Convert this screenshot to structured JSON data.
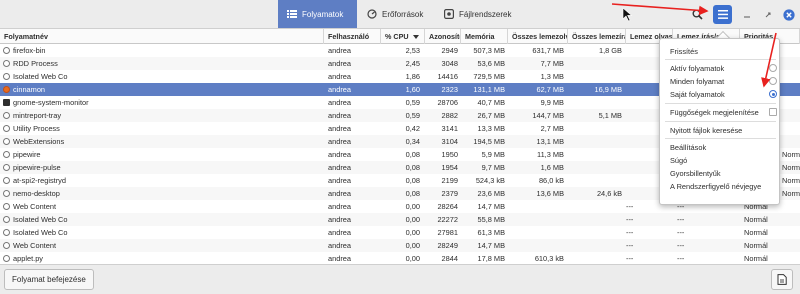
{
  "tabs": [
    {
      "label": "Folyamatok",
      "icon": "list-icon",
      "active": true
    },
    {
      "label": "Erőforrások",
      "icon": "gauge-icon",
      "active": false
    },
    {
      "label": "Fájlrendszerek",
      "icon": "disk-icon",
      "active": false
    }
  ],
  "columns": [
    "Folyamatnév",
    "Felhasználó",
    "% CPU",
    "Azonosító",
    "Memória",
    "Összes lemezolvasás",
    "Összes lemezírás",
    "Lemez olvasás/s",
    "Lemez írás/s",
    "Prioritás"
  ],
  "rows": [
    {
      "name": "firefox-bin",
      "user": "andrea",
      "cpu": "2,53",
      "pid": "2949",
      "mem": "507,3 MB",
      "read": "631,7 MB",
      "write": "1,8 GB",
      "rps": "",
      "wps": "",
      "prio": ""
    },
    {
      "name": "RDD Process",
      "user": "andrea",
      "cpu": "2,45",
      "pid": "3048",
      "mem": "53,6 MB",
      "read": "7,7 MB",
      "write": "",
      "rps": "",
      "wps": "",
      "prio": ""
    },
    {
      "name": "Isolated Web Co",
      "user": "andrea",
      "cpu": "1,86",
      "pid": "14416",
      "mem": "729,5 MB",
      "read": "1,3 MB",
      "write": "",
      "rps": "",
      "wps": "",
      "prio": ""
    },
    {
      "name": "cinnamon",
      "user": "andrea",
      "cpu": "1,60",
      "pid": "2323",
      "mem": "131,1 MB",
      "read": "62,7 MB",
      "write": "16,9 MB",
      "rps": "",
      "wps": "",
      "prio": ""
    },
    {
      "name": "gnome-system-monitor",
      "user": "andrea",
      "cpu": "0,59",
      "pid": "28706",
      "mem": "40,7 MB",
      "read": "9,9 MB",
      "write": "",
      "rps": "",
      "wps": "",
      "prio": ""
    },
    {
      "name": "mintreport-tray",
      "user": "andrea",
      "cpu": "0,59",
      "pid": "2882",
      "mem": "26,7 MB",
      "read": "144,7 MB",
      "write": "5,1 MB",
      "rps": "",
      "wps": "",
      "prio": ""
    },
    {
      "name": "Utility Process",
      "user": "andrea",
      "cpu": "0,42",
      "pid": "3141",
      "mem": "13,3 MB",
      "read": "2,7 MB",
      "write": "",
      "rps": "",
      "wps": "",
      "prio": ""
    },
    {
      "name": "WebExtensions",
      "user": "andrea",
      "cpu": "0,34",
      "pid": "3104",
      "mem": "194,5 MB",
      "read": "13,1 MB",
      "write": "",
      "rps": "",
      "wps": "",
      "prio": ""
    },
    {
      "name": "pipewire",
      "user": "andrea",
      "cpu": "0,08",
      "pid": "1950",
      "mem": "5,9 MB",
      "read": "11,3 MB",
      "write": "",
      "rps": "",
      "wps": "",
      "prio": ""
    },
    {
      "name": "pipewire-pulse",
      "user": "andrea",
      "cpu": "0,08",
      "pid": "1954",
      "mem": "9,7 MB",
      "read": "1,6 MB",
      "write": "",
      "rps": "",
      "wps": "",
      "prio": ""
    },
    {
      "name": "at-spi2-registryd",
      "user": "andrea",
      "cpu": "0,08",
      "pid": "2199",
      "mem": "524,3 kB",
      "read": "86,0 kB",
      "write": "",
      "rps": "",
      "wps": "",
      "prio": ""
    },
    {
      "name": "nemo-desktop",
      "user": "andrea",
      "cpu": "0,08",
      "pid": "2379",
      "mem": "23,6 MB",
      "read": "13,6 MB",
      "write": "24,6 kB",
      "rps": "",
      "wps": "",
      "prio": ""
    },
    {
      "name": "Web Content",
      "user": "andrea",
      "cpu": "0,00",
      "pid": "28264",
      "mem": "14,7 MB",
      "read": "",
      "write": "",
      "rps": "---",
      "wps": "---",
      "prio": "Normál"
    },
    {
      "name": "Isolated Web Co",
      "user": "andrea",
      "cpu": "0,00",
      "pid": "22272",
      "mem": "55,8 MB",
      "read": "",
      "write": "",
      "rps": "---",
      "wps": "---",
      "prio": "Normál"
    },
    {
      "name": "Isolated Web Co",
      "user": "andrea",
      "cpu": "0,00",
      "pid": "27981",
      "mem": "61,3 MB",
      "read": "",
      "write": "",
      "rps": "---",
      "wps": "---",
      "prio": "Normál"
    },
    {
      "name": "Web Content",
      "user": "andrea",
      "cpu": "0,00",
      "pid": "28249",
      "mem": "14,7 MB",
      "read": "",
      "write": "",
      "rps": "---",
      "wps": "---",
      "prio": "Normál"
    },
    {
      "name": "applet.py",
      "user": "andrea",
      "cpu": "0,00",
      "pid": "2844",
      "mem": "17,8 MB",
      "read": "610,3 kB",
      "write": "",
      "rps": "---",
      "wps": "---",
      "prio": "Normál"
    }
  ],
  "hidden_col_values": [
    "Normál",
    "Normál",
    "Normál",
    "Normál",
    "Normál",
    "Normál"
  ],
  "menu": {
    "refresh": "Frissítés",
    "active": "Aktív folyamatok",
    "all": "Minden folyamat",
    "own": "Saját folyamatok",
    "deps": "Függőségek megjelenítése",
    "open_files": "Nyitott fájlok keresése",
    "settings": "Beállítások",
    "help": "Súgó",
    "shortcuts": "Gyorsbillentyűk",
    "about": "A Rendszerfigyelő névjegye"
  },
  "footer": {
    "end_process": "Folyamat befejezése"
  },
  "colors": {
    "accent": "#5e7ec4",
    "menu_button": "#3c70cf",
    "annotation_arrows": "#e8211f"
  }
}
